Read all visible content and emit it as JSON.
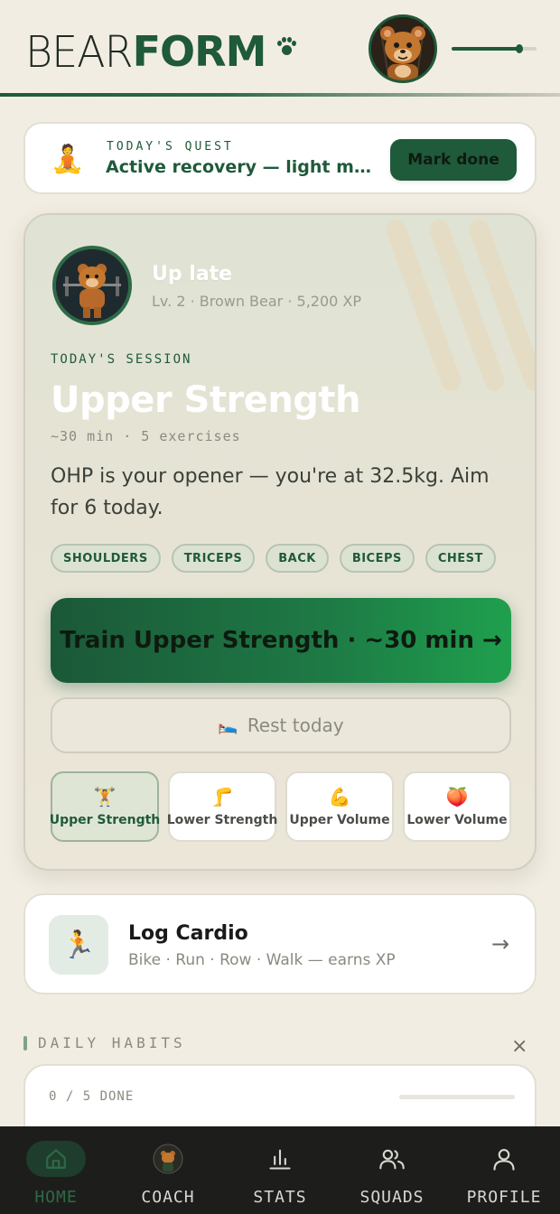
{
  "header": {
    "logo_light": "BEAR",
    "logo_bold": "FORM",
    "xp_progress": 0.8
  },
  "quest": {
    "label": "TODAY'S QUEST",
    "text": "Active recovery — light movement",
    "button": "Mark done",
    "icon": "🧘"
  },
  "session": {
    "user_name": "Up late",
    "level_line": "Lv. 2 · Brown Bear · 5,200 XP",
    "kicker": "TODAY'S SESSION",
    "title": "Upper Strength",
    "meta": "~30 min · 5 exercises",
    "description": "OHP is your opener — you're at 32.5kg. Aim for 6 today.",
    "tags": [
      "SHOULDERS",
      "TRICEPS",
      "BACK",
      "BICEPS",
      "CHEST"
    ],
    "train_button": "Train Upper Strength · ~30 min →",
    "rest_button": "Rest today",
    "rest_icon": "🛌",
    "choices": [
      {
        "icon": "🏋️",
        "label": "Upper Strength",
        "active": true
      },
      {
        "icon": "🦵",
        "label": "Lower Strength",
        "active": false
      },
      {
        "icon": "💪",
        "label": "Upper Volume",
        "active": false
      },
      {
        "icon": "🍑",
        "label": "Lower Volume",
        "active": false
      }
    ]
  },
  "cardio": {
    "icon": "🏃",
    "title": "Log Cardio",
    "subtitle": "Bike · Run · Row · Walk — earns XP",
    "arrow": "→"
  },
  "habits": {
    "label": "DAILY HABITS",
    "count": "0 / 5 DONE",
    "close": "×"
  },
  "nav": [
    {
      "label": "HOME",
      "icon": "home-icon",
      "active": true
    },
    {
      "label": "COACH",
      "icon": "coach-avatar-icon",
      "active": false
    },
    {
      "label": "STATS",
      "icon": "bar-chart-icon",
      "active": false
    },
    {
      "label": "SQUADS",
      "icon": "users-icon",
      "active": false
    },
    {
      "label": "PROFILE",
      "icon": "user-icon",
      "active": false
    }
  ],
  "colors": {
    "brand_green": "#1f5a3a",
    "background": "#f2ede2",
    "nav_bg": "#1d1e1c"
  }
}
